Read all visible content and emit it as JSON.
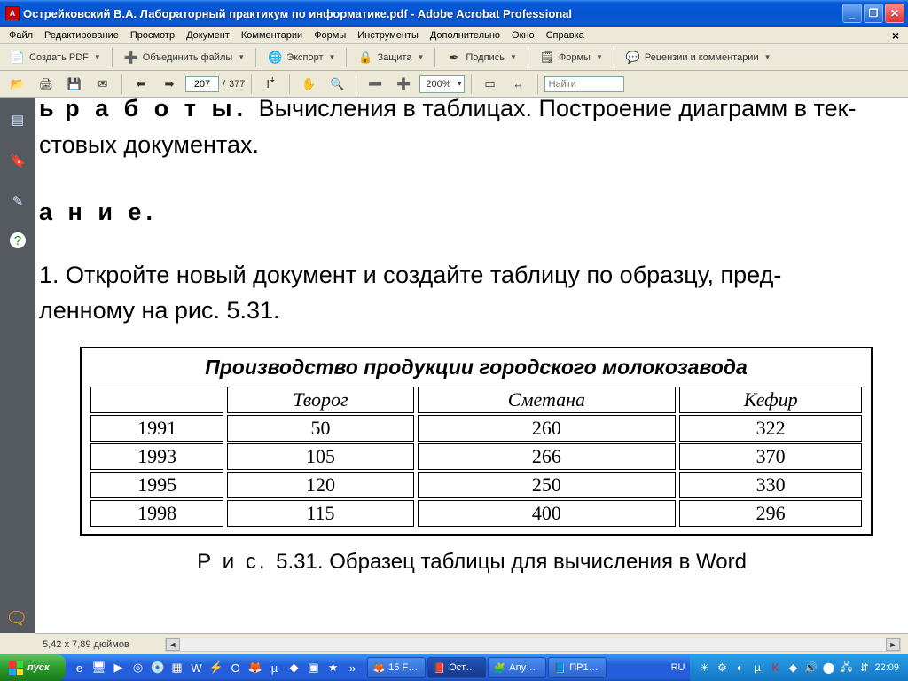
{
  "window": {
    "title": "Острейковский В.А. Лабораторный практикум по информатике.pdf - Adobe Acrobat Professional"
  },
  "menu": [
    "Файл",
    "Редактирование",
    "Просмотр",
    "Документ",
    "Комментарии",
    "Формы",
    "Инструменты",
    "Дополнительно",
    "Окно",
    "Справка"
  ],
  "toolbar1": {
    "create": "Создать PDF",
    "combine": "Объединить файлы",
    "export": "Экспорт",
    "secure": "Защита",
    "sign": "Подпись",
    "forms": "Формы",
    "review": "Рецензии и комментарии"
  },
  "toolbar2": {
    "page_current": "207",
    "page_sep": "/",
    "page_total": "377",
    "zoom": "200%",
    "find_placeholder": "Найти"
  },
  "document": {
    "line1_spaced": "ь",
    "line1_bold": " р а б о т ы. ",
    "line1_rest": "Вычисления в таблицах. Построение диаграмм в тек-",
    "line2": "стовых  документах.",
    "heading2": "а н и е.",
    "para1a": "1. Откройте новый документ и создайте таблицу по образцу, пред-",
    "para1b": "ленному  на  рис. 5.31.",
    "table_title": "Производство продукции городского молокозавода",
    "figcap_prefix": "Р и с. ",
    "figcap_rest": "5.31. Образец таблицы  для  вычисления  в Word"
  },
  "chart_data": {
    "type": "table",
    "headers": [
      "",
      "Творог",
      "Сметана",
      "Кефир"
    ],
    "rows": [
      [
        "1991",
        "50",
        "260",
        "322"
      ],
      [
        "1993",
        "105",
        "266",
        "370"
      ],
      [
        "1995",
        "120",
        "250",
        "330"
      ],
      [
        "1998",
        "115",
        "400",
        "296"
      ]
    ]
  },
  "status": {
    "dims": "5,42 x 7,89 дюймов"
  },
  "taskbar": {
    "start": "пуск",
    "lang": "RU",
    "clock": "22:09",
    "tasks": [
      {
        "icon": "🦊",
        "label": "15 F…"
      },
      {
        "icon": "📕",
        "label": "Ост…",
        "active": true
      },
      {
        "icon": "🧩",
        "label": "Any…"
      },
      {
        "icon": "📘",
        "label": "ПР1…"
      }
    ]
  }
}
